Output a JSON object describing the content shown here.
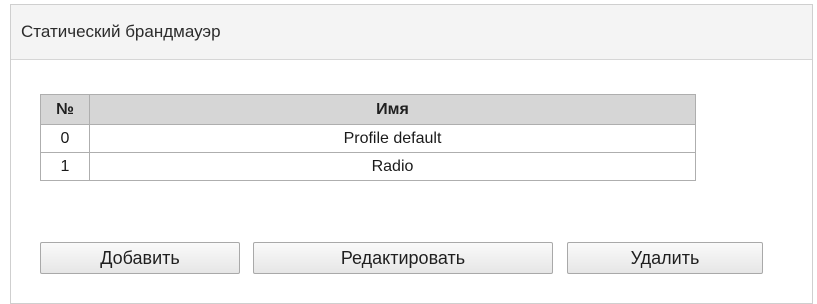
{
  "panel": {
    "title": "Статический брандмауэр"
  },
  "table": {
    "headers": {
      "num": "№",
      "name": "Имя"
    },
    "rows": [
      {
        "num": "0",
        "name": "Profile default"
      },
      {
        "num": "1",
        "name": "Radio"
      }
    ]
  },
  "buttons": {
    "add_label": "Добавить",
    "edit_label": "Редактировать",
    "delete_label": "Удалить"
  }
}
